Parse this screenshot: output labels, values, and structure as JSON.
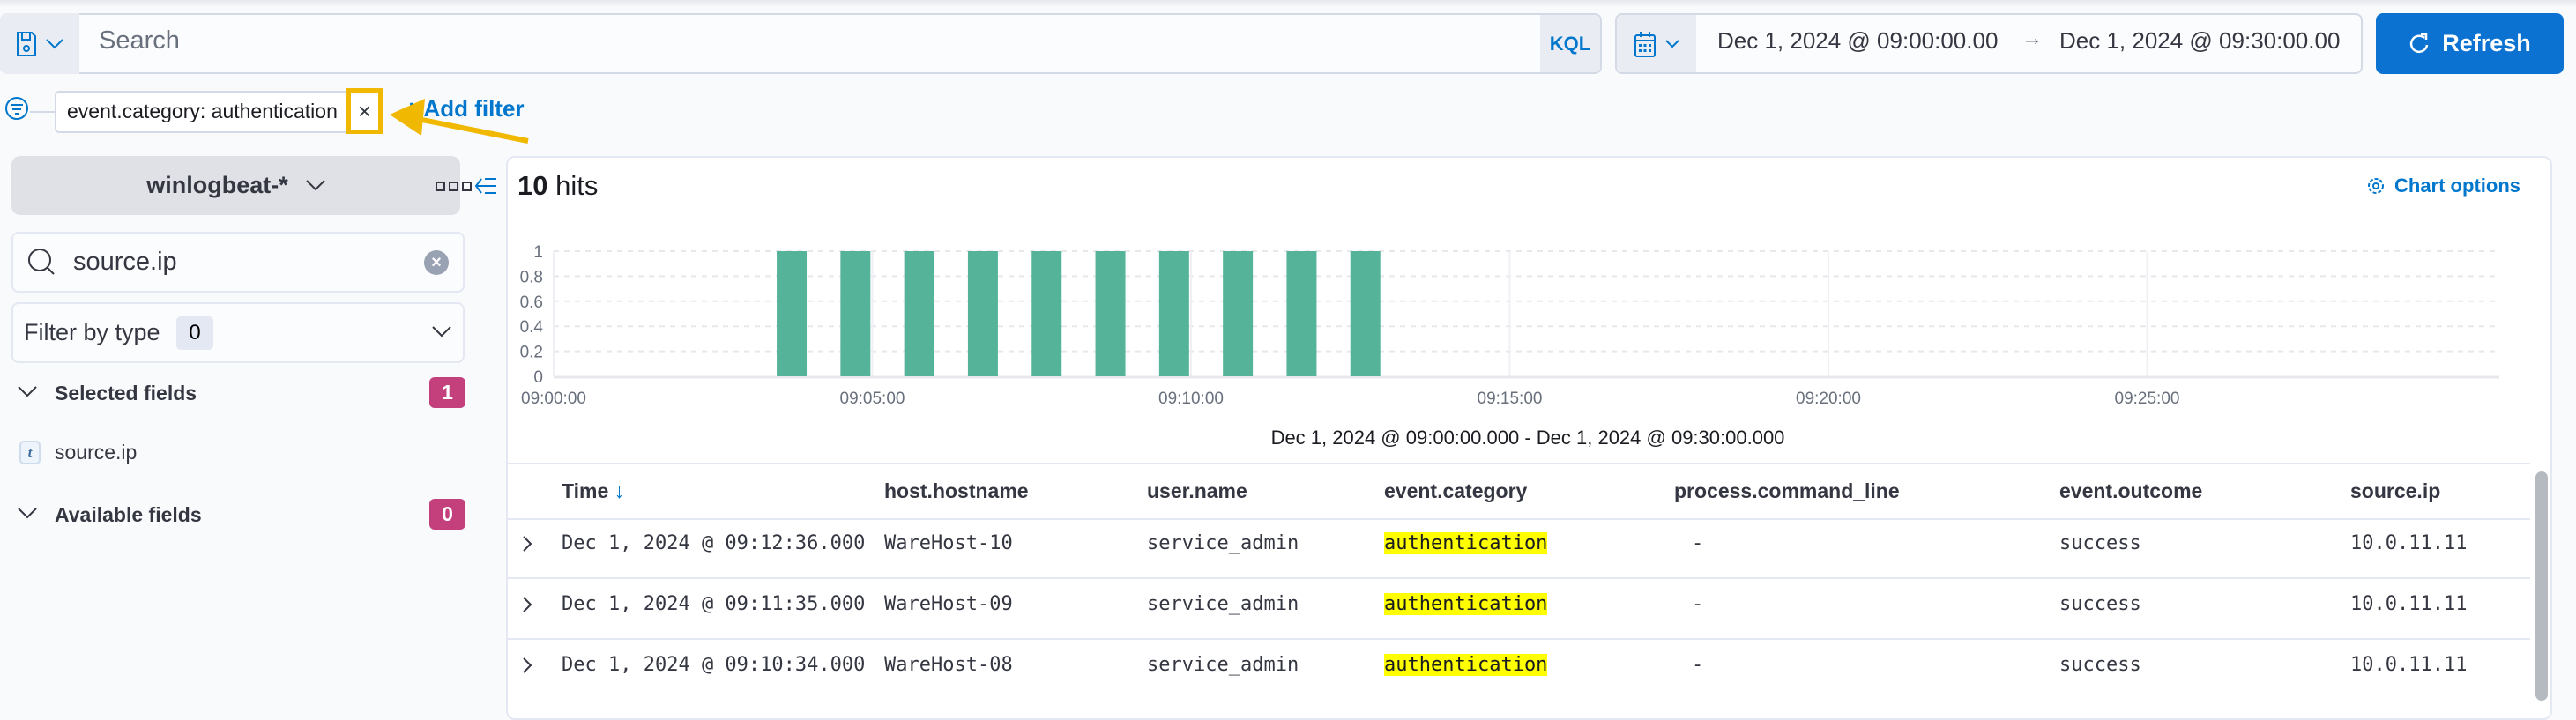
{
  "query_bar": {
    "search_placeholder": "Search",
    "language_label": "KQL",
    "time_start": "Dec 1, 2024 @ 09:00:00.00",
    "time_end": "Dec 1, 2024 @ 09:30:00.00",
    "refresh_label": "Refresh"
  },
  "filters": {
    "pills": [
      {
        "label": "event.category: authentication"
      }
    ],
    "add_filter_label": "+ Add filter"
  },
  "sidebar": {
    "index_pattern": "winlogbeat-*",
    "field_search_value": "source.ip",
    "filter_by_type_label": "Filter by type",
    "filter_by_type_count": "0",
    "selected_fields_label": "Selected fields",
    "selected_fields_count": "1",
    "selected_fields": [
      {
        "type": "t",
        "name": "source.ip"
      }
    ],
    "available_fields_label": "Available fields",
    "available_fields_count": "0"
  },
  "main": {
    "hits_count": "10",
    "hits_label": "hits",
    "chart_options_label": "Chart options"
  },
  "chart_data": {
    "type": "bar",
    "title": "",
    "xlabel": "Dec 1, 2024 @ 09:00:00.000 - Dec 1, 2024 @ 09:30:00.000",
    "ylabel": "",
    "x_unit": "minutes after 09:00:00",
    "bucket_minutes": 0.5,
    "x": [
      3.5,
      4.5,
      5.5,
      6.5,
      7.5,
      8.5,
      9.5,
      10.5,
      11.5,
      12.5
    ],
    "values": [
      1,
      1,
      1,
      1,
      1,
      1,
      1,
      1,
      1,
      1
    ],
    "xlim": [
      0,
      30
    ],
    "ylim": [
      0,
      1
    ],
    "x_ticks": [
      0,
      5,
      10,
      15,
      20,
      25
    ],
    "x_tick_labels": [
      "09:00:00",
      "09:05:00",
      "09:10:00",
      "09:15:00",
      "09:20:00",
      "09:25:00"
    ],
    "y_ticks": [
      0,
      0.2,
      0.4,
      0.6,
      0.8,
      1
    ],
    "y_tick_labels": [
      "0",
      "0.2",
      "0.4",
      "0.6",
      "0.8",
      "1"
    ],
    "grid": true,
    "color": "#54B399"
  },
  "table": {
    "columns": [
      "Time",
      "host.hostname",
      "user.name",
      "event.category",
      "process.command_line",
      "event.outcome",
      "source.ip"
    ],
    "rows": [
      [
        "Dec 1, 2024 @ 09:12:36.000",
        "WareHost-10",
        "service_admin",
        "authentication",
        "-",
        "success",
        "10.0.11.11"
      ],
      [
        "Dec 1, 2024 @ 09:11:35.000",
        "WareHost-09",
        "service_admin",
        "authentication",
        "-",
        "success",
        "10.0.11.11"
      ],
      [
        "Dec 1, 2024 @ 09:10:34.000",
        "WareHost-08",
        "service_admin",
        "authentication",
        "-",
        "success",
        "10.0.11.11"
      ]
    ]
  }
}
